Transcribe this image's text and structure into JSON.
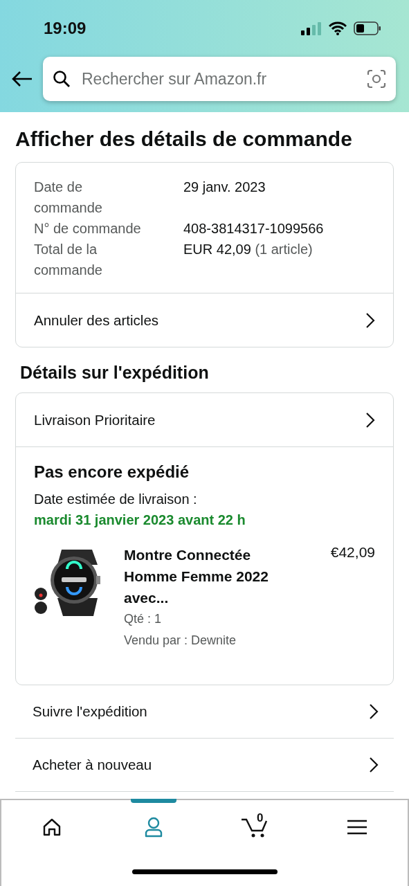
{
  "status_bar": {
    "time": "19:09"
  },
  "search": {
    "placeholder": "Rechercher sur Amazon.fr"
  },
  "title": "Afficher des détails de commande",
  "order_summary": {
    "rows": [
      {
        "label": "Date de commande",
        "value": "29 janv. 2023"
      },
      {
        "label": "N° de commande",
        "value": "408-3814317-1099566"
      },
      {
        "label": "Total de la commande",
        "value": "EUR 42,09",
        "note": "(1 article)"
      }
    ],
    "action": "Annuler des articles"
  },
  "shipping_title": "Détails sur l'expédition",
  "shipment": {
    "method": "Livraison Prioritaire",
    "status": "Pas encore expédié",
    "estimate_label": "Date estimée de livraison :",
    "estimate_date": "mardi 31 janvier 2023 avant 22 h",
    "item": {
      "kind": "picture",
      "name": "Montre Connectée Homme Femme 2022 avec...",
      "price": "€42,09",
      "quantity": "Qté : 1",
      "seller": "Vendu par : Dewnite"
    }
  },
  "actions": [
    "Suivre l'expédition",
    "Acheter à nouveau"
  ],
  "tab_bar": [
    {
      "kind": "home",
      "selected": false
    },
    {
      "kind": "account",
      "selected": true
    },
    {
      "kind": "cart",
      "selected": false,
      "count": "0"
    },
    {
      "kind": "menu",
      "selected": false
    }
  ]
}
